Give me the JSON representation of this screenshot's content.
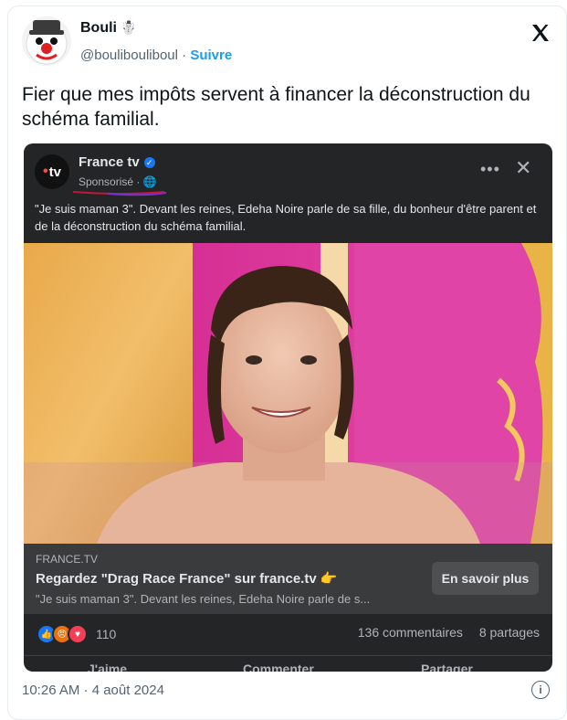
{
  "tweet": {
    "author_name": "Bouli",
    "author_emoji": "☃️",
    "handle": "@boulibouliboul",
    "separator": "·",
    "follow_label": "Suivre",
    "text": "Fier que mes impôts servent à financer la déconstruction du schéma familial.",
    "timestamp": "10:26 AM · 4 août 2024"
  },
  "fb_post": {
    "page_name": "France tv",
    "logo_text": "tv",
    "sponsored": "Sponsorisé ·",
    "more": "•••",
    "close": "✕",
    "text": "\"Je suis maman 3\". Devant les reines, Edeha Noire parle de sa fille, du bonheur d'être parent et de la déconstruction du schéma familial.",
    "link_domain": "FRANCE.TV",
    "link_title": "Regardez \"Drag Race France\" sur france.tv 👉",
    "link_desc": "\"Je suis maman 3\". Devant les reines, Edeha Noire parle de s...",
    "cta": "En savoir plus",
    "reaction_count": "110",
    "comments": "136 commentaires",
    "shares": "8 partages",
    "actions": [
      "J'aime",
      "Commenter",
      "Partager"
    ]
  },
  "colors": {
    "twitter_blue": "#1d9bf0",
    "fb_dark": "#242526",
    "fb_link_bg": "#3a3b3c",
    "annotation_red": "#c0193a",
    "annotation_purple": "#7b2fd1"
  }
}
